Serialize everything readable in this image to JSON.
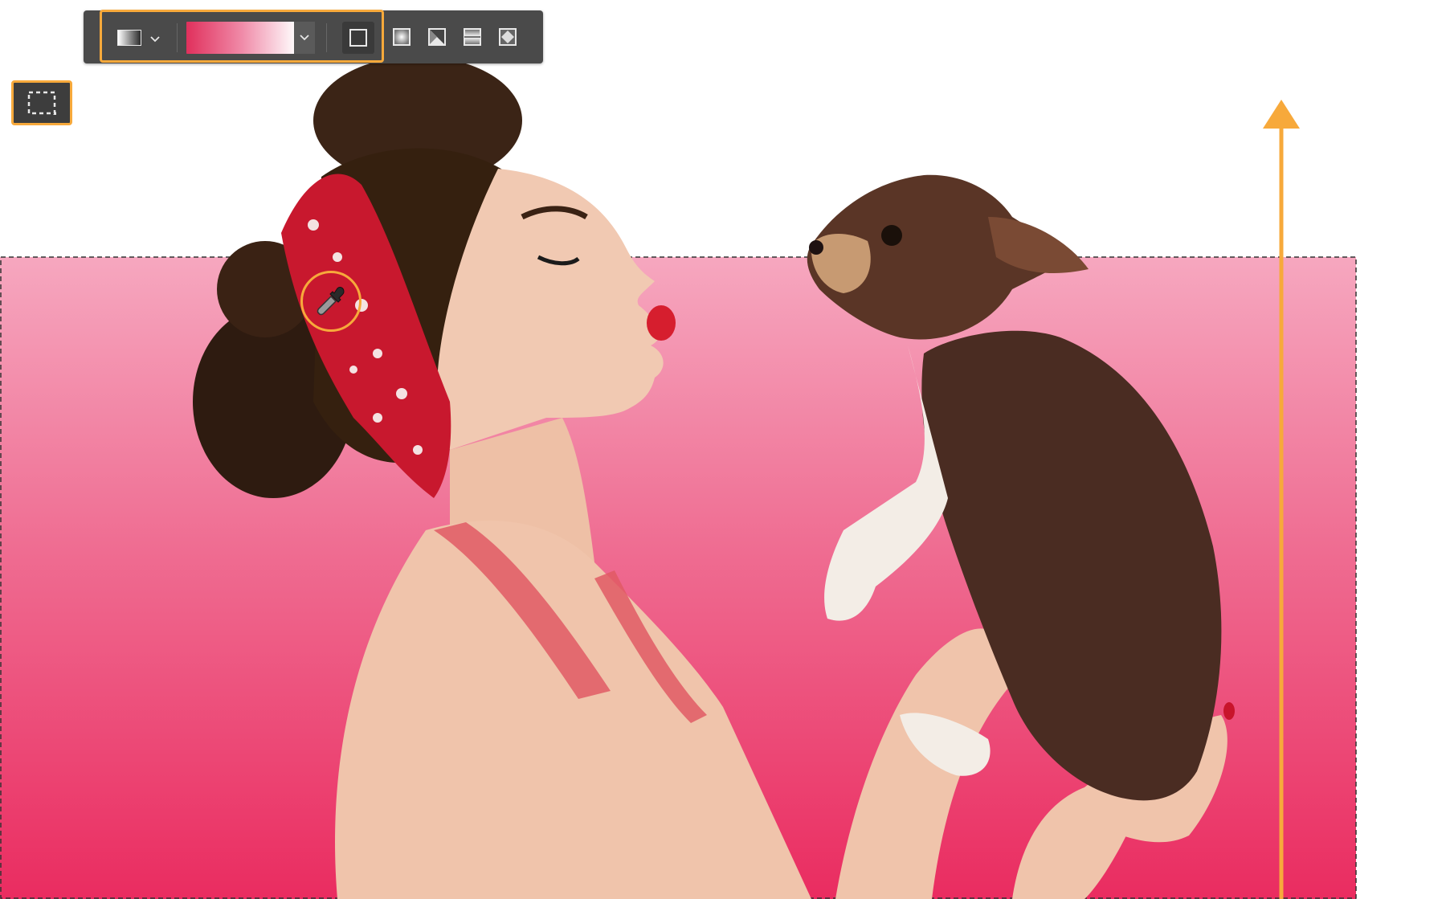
{
  "toolbar": {
    "preset_icon": "gradient-preset-swatch-icon",
    "preset_dropdown_icon": "chevron-down-icon",
    "gradient_picker_icon": "chevron-down-icon",
    "modes": [
      {
        "name": "linear-gradient-icon",
        "selected": true
      },
      {
        "name": "radial-gradient-icon",
        "selected": false
      },
      {
        "name": "angle-gradient-icon",
        "selected": false
      },
      {
        "name": "reflected-gradient-icon",
        "selected": false
      },
      {
        "name": "diamond-gradient-icon",
        "selected": false
      }
    ]
  },
  "gradient": {
    "stops": [
      "#e0305c",
      "#f08aa8",
      "#ffffff"
    ],
    "fill_top": "#f6a7bf",
    "fill_bottom": "#ea2c60"
  },
  "tools": {
    "active_tool": "rectangular-marquee-icon"
  },
  "annotations": {
    "highlight_color": "#f7a93b",
    "sample_tool": "eyedropper-icon",
    "drag_direction": "up"
  }
}
